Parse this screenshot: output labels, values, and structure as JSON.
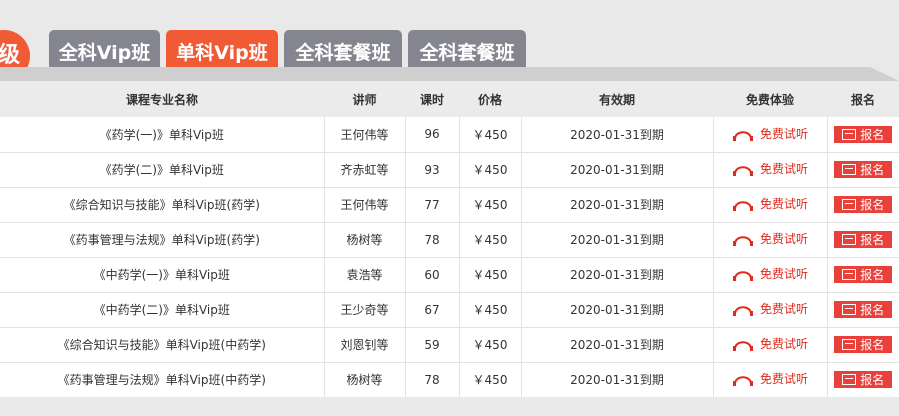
{
  "badge": {
    "text": "级"
  },
  "tabs": [
    {
      "label": "全科Vip班",
      "active": false
    },
    {
      "label": "单科Vip班",
      "active": true
    },
    {
      "label": "全科套餐班",
      "active": false
    },
    {
      "label": "全科套餐班",
      "active": false
    }
  ],
  "table": {
    "headers": {
      "name": "课程专业名称",
      "teacher": "讲师",
      "hours": "课时",
      "price": "价格",
      "valid": "有效期",
      "trial": "免费体验",
      "signup": "报名"
    },
    "rows": [
      {
        "name": "《药学(一)》单科Vip班",
        "teacher": "王何伟等",
        "hours": "96",
        "price": "￥450",
        "valid": "2020-01-31到期",
        "trial": "免费试听",
        "signup": "报名"
      },
      {
        "name": "《药学(二)》单科Vip班",
        "teacher": "齐赤虹等",
        "hours": "93",
        "price": "￥450",
        "valid": "2020-01-31到期",
        "trial": "免费试听",
        "signup": "报名"
      },
      {
        "name": "《综合知识与技能》单科Vip班(药学)",
        "teacher": "王何伟等",
        "hours": "77",
        "price": "￥450",
        "valid": "2020-01-31到期",
        "trial": "免费试听",
        "signup": "报名"
      },
      {
        "name": "《药事管理与法规》单科Vip班(药学)",
        "teacher": "杨树等",
        "hours": "78",
        "price": "￥450",
        "valid": "2020-01-31到期",
        "trial": "免费试听",
        "signup": "报名"
      },
      {
        "name": "《中药学(一)》单科Vip班",
        "teacher": "袁浩等",
        "hours": "60",
        "price": "￥450",
        "valid": "2020-01-31到期",
        "trial": "免费试听",
        "signup": "报名"
      },
      {
        "name": "《中药学(二)》单科Vip班",
        "teacher": "王少奇等",
        "hours": "67",
        "price": "￥450",
        "valid": "2020-01-31到期",
        "trial": "免费试听",
        "signup": "报名"
      },
      {
        "name": "《综合知识与技能》单科Vip班(中药学)",
        "teacher": "刘恩钊等",
        "hours": "59",
        "price": "￥450",
        "valid": "2020-01-31到期",
        "trial": "免费试听",
        "signup": "报名"
      },
      {
        "name": "《药事管理与法规》单科Vip班(中药学)",
        "teacher": "杨树等",
        "hours": "78",
        "price": "￥450",
        "valid": "2020-01-31到期",
        "trial": "免费试听",
        "signup": "报名"
      }
    ]
  },
  "icons": {
    "trial": "headphones-icon",
    "signup": "cart-icon"
  },
  "colors": {
    "accent": "#f05a34",
    "tab_inactive": "#85858f",
    "trial_text": "#e02a1c",
    "signup_bg": "#e8403a"
  }
}
